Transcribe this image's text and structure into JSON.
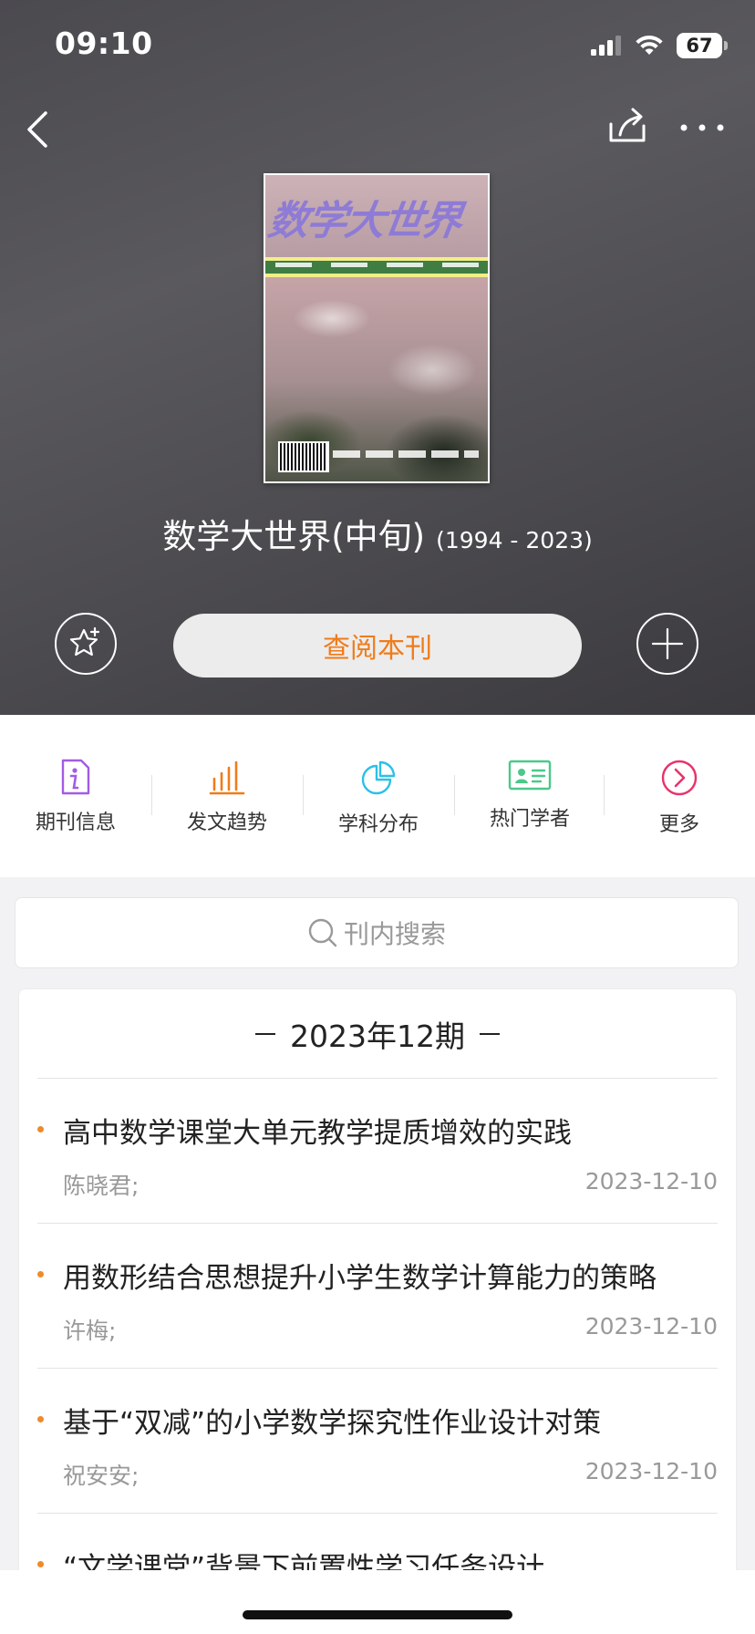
{
  "status_bar": {
    "time": "09:10",
    "battery": "67"
  },
  "nav": {
    "back": "back-icon",
    "share": "share-icon",
    "more": "more-icon"
  },
  "journal": {
    "name": "数学大世界(中旬)",
    "years": "(1994 - 2023)",
    "cover_masthead": "数学大世界"
  },
  "actions": {
    "read_label": "查阅本刊",
    "favorite_icon": "star-plus-icon",
    "add_icon": "plus-icon",
    "accent": "#ef7c1b"
  },
  "functions": [
    {
      "label": "期刊信息",
      "icon": "info-doc-icon",
      "color": "#a35be6"
    },
    {
      "label": "发文趋势",
      "icon": "bar-chart-icon",
      "color": "#ef7c1b"
    },
    {
      "label": "学科分布",
      "icon": "pie-chart-icon",
      "color": "#2cc0e6"
    },
    {
      "label": "热门学者",
      "icon": "id-card-icon",
      "color": "#4cc88a"
    },
    {
      "label": "更多",
      "icon": "chevron-circle-icon",
      "color": "#e8336a"
    }
  ],
  "search": {
    "placeholder": "刊内搜索"
  },
  "issue": {
    "label": "2023年12期",
    "articles": [
      {
        "title": "高中数学课堂大单元教学提质增效的实践",
        "author": "陈晓君;",
        "date": "2023-12-10"
      },
      {
        "title": "用数形结合思想提升小学生数学计算能力的策略",
        "author": "许梅;",
        "date": "2023-12-10"
      },
      {
        "title": "基于“双减”的小学数学探究性作业设计对策",
        "author": "祝安安;",
        "date": "2023-12-10"
      },
      {
        "title": "“文学课堂”背景下前置性学习任务设计",
        "author": "",
        "date": ""
      }
    ]
  }
}
